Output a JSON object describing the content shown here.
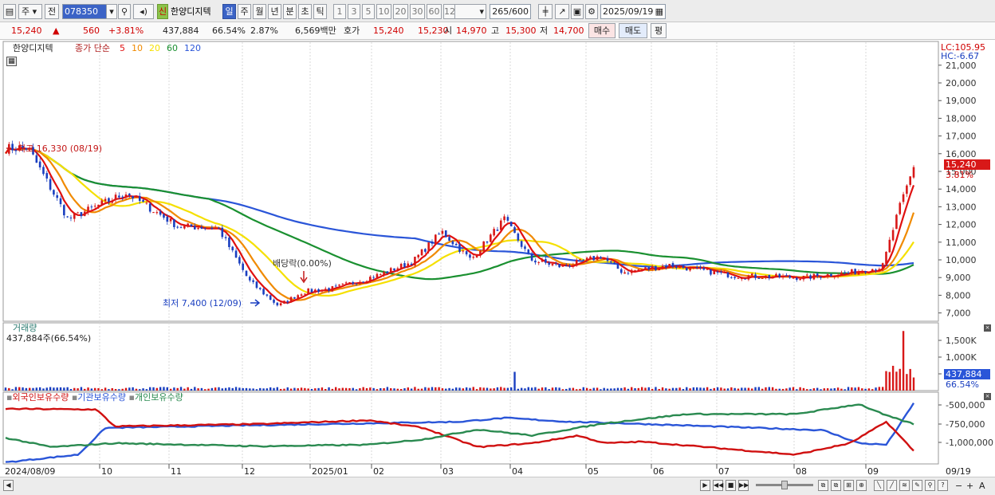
{
  "toolbar": {
    "period_type": "주",
    "prev_label": "전",
    "stock_code": "078350",
    "new_badge": "신",
    "stock_name": "한양디지텍",
    "periods": [
      "일",
      "주",
      "월",
      "년",
      "분",
      "초",
      "틱"
    ],
    "selected_period": "일",
    "intervals": [
      "1",
      "3",
      "5",
      "10",
      "20",
      "30",
      "60",
      "120"
    ],
    "count": "265",
    "count_total": "/600",
    "date": "2025/09/19"
  },
  "quote": {
    "price": "15,240",
    "change": "560",
    "change_pct": "+3.81%",
    "volume": "437,884",
    "volume_ratio": "66.54%",
    "turnover": "2.87%",
    "amount": "6,569백만",
    "bid_label": "호가",
    "ask": "15,240",
    "bid": "15,230",
    "open_label": "시",
    "open": "14,970",
    "high_label": "고",
    "high": "15,300",
    "low_label": "저",
    "low": "14,700",
    "buy_label": "매수",
    "sell_label": "매도",
    "avg_label": "평"
  },
  "price_panel": {
    "stock_name": "한양디지텍",
    "series_prefix": "종가 단순",
    "ma_periods": [
      "5",
      "10",
      "20",
      "60",
      "120"
    ],
    "ma_colors": [
      "#e01010",
      "#f08a00",
      "#f5e000",
      "#1a9030",
      "#2a55d8"
    ],
    "lc": "LC:105.95",
    "hc": "HC:-6.67",
    "last_price": "15,240",
    "last_pct": "3.81%",
    "high_note": "최고 16,330 (08/19)",
    "low_note": "최저 7,400 (12/09)",
    "dividend_note": "배당락(0.00%)",
    "y_ticks": [
      "21,000",
      "20,000",
      "19,000",
      "18,000",
      "17,000",
      "16,000",
      "15,000",
      "14,000",
      "13,000",
      "12,000",
      "11,000",
      "10,000",
      "9,000",
      "8,000",
      "7,000"
    ]
  },
  "volume_panel": {
    "title": "거래량",
    "value_note": "437,884주(66.54%)",
    "y_ticks": [
      "1,500K",
      "1,000K",
      "500K"
    ],
    "last_value": "437,884",
    "last_pct": "66.54%"
  },
  "holdings_panel": {
    "legend": [
      "외국인보유수량",
      "기관보유수량",
      "개인보유수량"
    ],
    "colors": [
      "#d01010",
      "#2a55d8",
      "#2a8a50"
    ],
    "y_ticks": [
      "-500,000",
      "-750,000",
      "-1,000,000"
    ]
  },
  "x_axis": {
    "labels": [
      "2024/08/09",
      "10",
      "11",
      "12",
      "2025/01",
      "02",
      "03",
      "04",
      "05",
      "06",
      "07",
      "08",
      "09"
    ],
    "right_label": "09/19"
  },
  "chart_data": {
    "type": "candlestick",
    "price_range": [
      6500,
      21700
    ],
    "close_keypoints": [
      {
        "date": "2024/08/09",
        "close": 16300
      },
      {
        "date": "2024/08/19",
        "close": 16330
      },
      {
        "date": "2024/09/06",
        "close": 12300
      },
      {
        "date": "2024/10/02",
        "close": 13800
      },
      {
        "date": "2024/10/25",
        "close": 11900
      },
      {
        "date": "2024/11/12",
        "close": 11800
      },
      {
        "date": "2024/11/26",
        "close": 8800
      },
      {
        "date": "2024/12/09",
        "close": 7400
      },
      {
        "date": "2024/12/20",
        "close": 8200
      },
      {
        "date": "2025/01/03",
        "close": 8400
      },
      {
        "date": "2025/01/24",
        "close": 9200
      },
      {
        "date": "2025/02/07",
        "close": 9900
      },
      {
        "date": "2025/02/20",
        "close": 11600
      },
      {
        "date": "2025/03/05",
        "close": 10000
      },
      {
        "date": "2025/03/20",
        "close": 12300
      },
      {
        "date": "2025/04/01",
        "close": 10000
      },
      {
        "date": "2025/04/15",
        "close": 9600
      },
      {
        "date": "2025/05/02",
        "close": 10200
      },
      {
        "date": "2025/05/12",
        "close": 9300
      },
      {
        "date": "2025/06/02",
        "close": 9700
      },
      {
        "date": "2025/07/01",
        "close": 9100
      },
      {
        "date": "2025/08/01",
        "close": 9000
      },
      {
        "date": "2025/08/22",
        "close": 9300
      },
      {
        "date": "2025/09/05",
        "close": 9600
      },
      {
        "date": "2025/09/12",
        "close": 12700
      },
      {
        "date": "2025/09/19",
        "close": 15240
      }
    ],
    "volume_spikes_k": [
      {
        "date": "2025/03/25",
        "value": 560
      },
      {
        "date": "2025/09/15",
        "value": 1780
      }
    ]
  }
}
